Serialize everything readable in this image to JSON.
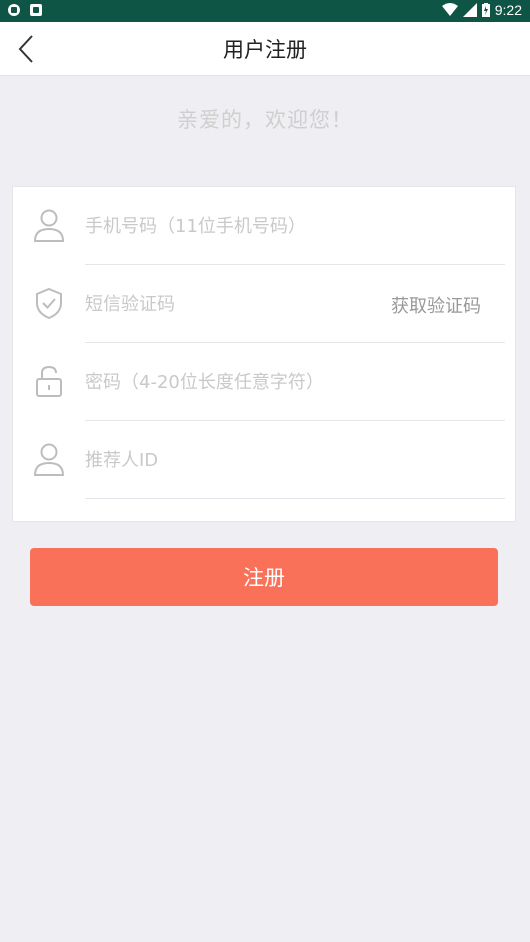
{
  "status_bar": {
    "time": "9:22"
  },
  "header": {
    "title": "用户注册"
  },
  "welcome": "亲爱的，欢迎您！",
  "form": {
    "phone_placeholder": "手机号码（11位手机号码）",
    "code_placeholder": "短信验证码",
    "get_code_label": "获取验证码",
    "password_placeholder": "密码（4-20位长度任意字符）",
    "referrer_placeholder": "推荐人ID"
  },
  "register_label": "注册",
  "colors": {
    "status_bar": "#0e5545",
    "accent": "#f97159",
    "background": "#efeef3"
  },
  "icons": [
    "back-arrow-icon",
    "user-icon",
    "shield-check-icon",
    "lock-icon",
    "user-icon"
  ]
}
